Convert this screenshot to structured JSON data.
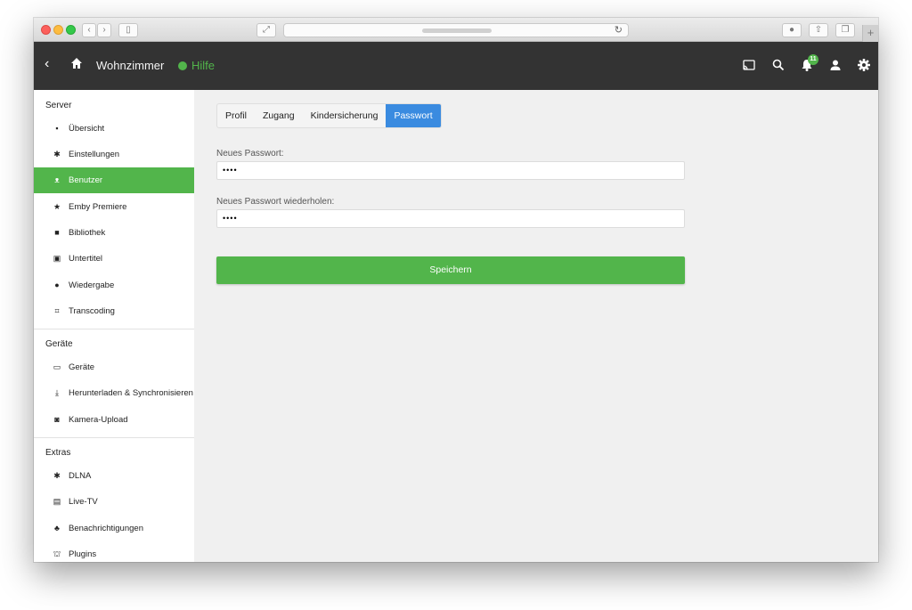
{
  "header": {
    "back_label": "‹",
    "title": "Wohnzimmer",
    "help_label": "Hilfe",
    "notification_count": "11"
  },
  "sidebar": {
    "sections": [
      {
        "heading": "Server",
        "items": [
          {
            "label": "Übersicht",
            "icon": "dashboard-icon",
            "glyph": "▪"
          },
          {
            "label": "Einstellungen",
            "icon": "gear-icon",
            "glyph": "✱"
          },
          {
            "label": "Benutzer",
            "icon": "people-icon",
            "glyph": "ᴥ",
            "active": true
          },
          {
            "label": "Emby Premiere",
            "icon": "star-icon",
            "glyph": "★"
          },
          {
            "label": "Bibliothek",
            "icon": "folder-icon",
            "glyph": "■"
          },
          {
            "label": "Untertitel",
            "icon": "subtitles-icon",
            "glyph": "▣"
          },
          {
            "label": "Wiedergabe",
            "icon": "play-circle-icon",
            "glyph": "●"
          },
          {
            "label": "Transcoding",
            "icon": "transform-icon",
            "glyph": "⌗"
          }
        ]
      },
      {
        "heading": "Geräte",
        "items": [
          {
            "label": "Geräte",
            "icon": "devices-icon",
            "glyph": "▭"
          },
          {
            "label": "Herunterladen & Synchronisieren",
            "icon": "download-icon",
            "glyph": "⤓"
          },
          {
            "label": "Kamera-Upload",
            "icon": "camera-icon",
            "glyph": "◙"
          }
        ]
      },
      {
        "heading": "Extras",
        "items": [
          {
            "label": "DLNA",
            "icon": "dlna-icon",
            "glyph": "✱"
          },
          {
            "label": "Live-TV",
            "icon": "tv-icon",
            "glyph": "▤"
          },
          {
            "label": "Benachrichtigungen",
            "icon": "bell-icon",
            "glyph": "♣"
          },
          {
            "label": "Plugins",
            "icon": "plugin-icon",
            "glyph": "⛫"
          }
        ]
      }
    ]
  },
  "main": {
    "tabs": [
      {
        "label": "Profil",
        "active": false
      },
      {
        "label": "Zugang",
        "active": false
      },
      {
        "label": "Kindersicherung",
        "active": false
      },
      {
        "label": "Passwort",
        "active": true
      }
    ],
    "new_password_label": "Neues Passwort:",
    "new_password_value": "••••",
    "repeat_password_label": "Neues Passwort wiederholen:",
    "repeat_password_value": "••••",
    "save_label": "Speichern"
  },
  "colors": {
    "accent_green": "#52b54b",
    "tab_active_blue": "#3a8be0",
    "header_bg": "#333333"
  }
}
